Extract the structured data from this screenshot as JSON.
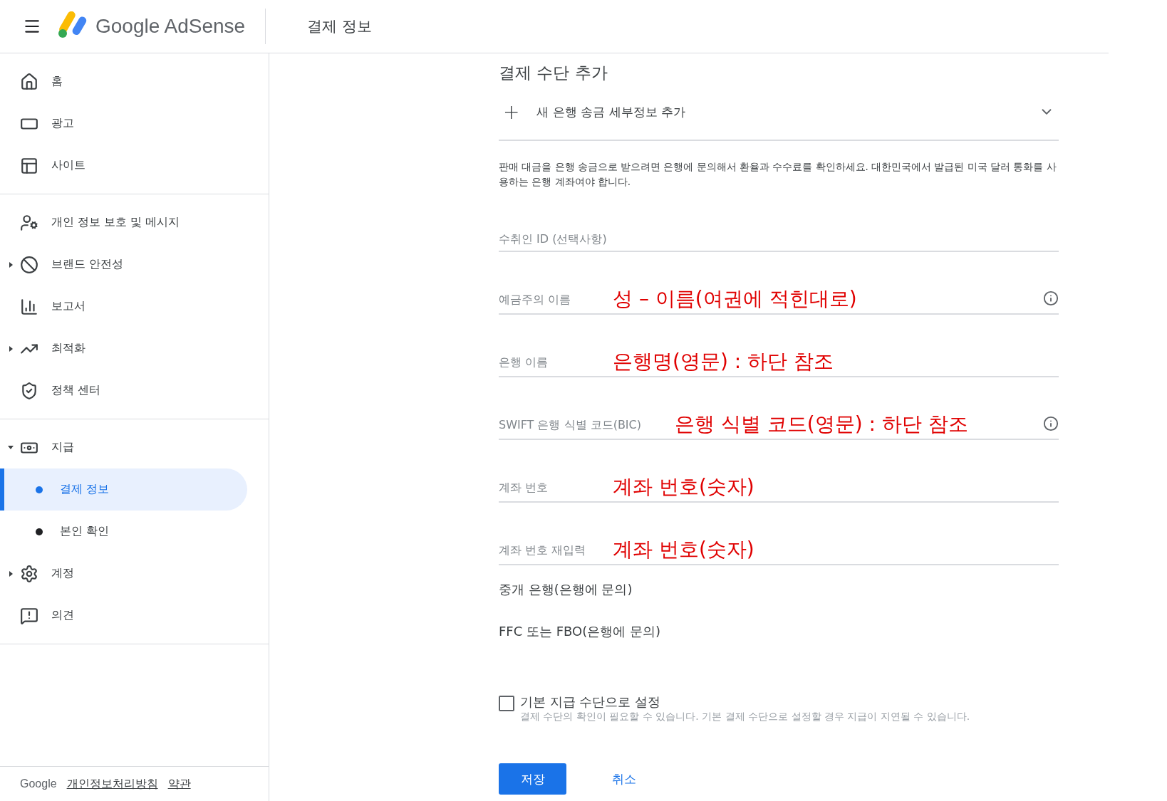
{
  "header": {
    "product": "Google AdSense",
    "page_title": "결제 정보"
  },
  "sidebar": {
    "groups": [
      [
        {
          "label": "홈",
          "selected": false
        },
        {
          "label": "광고",
          "selected": false
        },
        {
          "label": "사이트",
          "selected": false
        }
      ],
      [
        {
          "label": "개인 정보 보호 및 메시지",
          "selected": false
        },
        {
          "label": "브랜드 안전성",
          "selected": false,
          "expanded": false
        },
        {
          "label": "보고서",
          "selected": false
        },
        {
          "label": "최적화",
          "selected": false,
          "expanded": false
        },
        {
          "label": "정책 센터",
          "selected": false
        }
      ],
      [
        {
          "label": "지급",
          "selected": false,
          "expanded": true,
          "children": [
            {
              "label": "결제 정보",
              "selected": true
            },
            {
              "label": "본인 확인",
              "selected": false
            }
          ]
        },
        {
          "label": "계정",
          "selected": false,
          "expanded": false
        },
        {
          "label": "의견",
          "selected": false
        }
      ]
    ],
    "footer": {
      "brand": "Google",
      "links": [
        "개인정보처리방침",
        "약관"
      ]
    }
  },
  "form": {
    "title": "결제 수단 추가",
    "add_row": {
      "icon_text": "+",
      "label": "새 은행 송금 세부정보 추가",
      "expanded": false
    },
    "description": "판매 대금을 은행 송금으로 받으려면 은행에 문의해서 환율과 수수료를 확인하세요. 대한민국에서 발급된 미국 달러 통화를 사용하는 은행 계좌여야 합니다.",
    "fields": [
      {
        "placeholder": "수취인 ID (선택사항)",
        "info": false
      },
      {
        "label": "예금주의 이름",
        "value": "성 – 이름(여권에 적힌대로)",
        "info": true
      },
      {
        "label": "은행 이름",
        "value": "은행명(영문) : 하단 참조",
        "info": false
      },
      {
        "label": "SWIFT 은행 식별 코드(BIC)",
        "value": "은행 식별 코드(영문) : 하단 참조",
        "info": true
      },
      {
        "label": "계좌 번호",
        "value": "계좌 번호(숫자)",
        "info": false
      },
      {
        "label": "계좌 번호 재입력",
        "value": "계좌 번호(숫자)",
        "info": false
      }
    ],
    "optional_links": [
      "중개 은행(은행에 문의)",
      "FFC 또는 FBO(은행에 문의)"
    ],
    "default_checkbox": {
      "label": "기본 지급 수단으로 설정",
      "checked": false,
      "note": "결제 수단의 확인이 필요할 수 있습니다. 기본 결제 수단으로 설정할 경우 지급이 지연될 수 있습니다."
    },
    "buttons": {
      "save": "저장",
      "cancel": "취소"
    }
  }
}
